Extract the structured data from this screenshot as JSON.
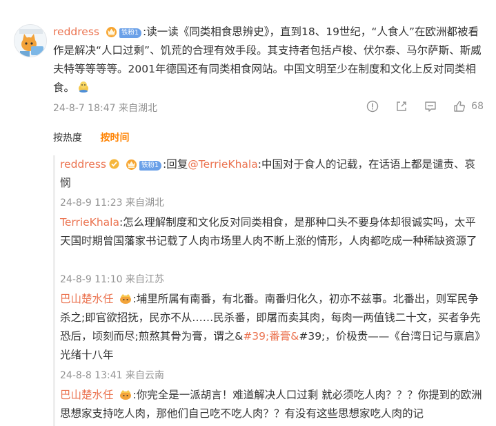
{
  "main_comment": {
    "user": "reddress",
    "fan_badge": "铁粉1",
    "text": ":读一读《同类相食思辨史》，直到18、19世纪，“人食人”在欧洲都被看作是解决“人口过剩”、饥荒的合理有效手段。其支持者包括卢梭、伏尔泰、马尔萨斯、斯威夫特等等等等。2001年德国还有同类相食网站。中国文明至少在制度和文化上反对同类相食。",
    "emoji_icon": "doge-emoji-icon",
    "time_location": "24-8-7 18:47 来自湖北",
    "like_count": "68"
  },
  "actions": {
    "icons": [
      "info-icon",
      "share-icon",
      "comment-icon",
      "like-icon"
    ]
  },
  "sort": {
    "hot": "按热度",
    "time": "按时间"
  },
  "replies": [
    {
      "user": "reddress",
      "fan_badge": "铁粉1",
      "prefix": ":回复",
      "mention": "@TerrieKhala",
      "text": ":中国对于食人的记载，在话语上都是谴责、哀悯",
      "time_location": "24-8-9 11:23 来自湖北"
    },
    {
      "user": "TerrieKhala",
      "text": ":怎么理解制度和文化反对同类相食，是那种口头不要身体却很诚实吗，太平天国时期曾国藩家书记载了人肉市场里人肉不断上涨的情形，人肉都吃成一种稀缺资源了",
      "time_location": "24-8-9 11:10 来自江苏"
    },
    {
      "user": "巴山楚水任",
      "text_a": ":埔里所属有南番，有北番。南番归化久，初亦不兹事。北番出，则军民争杀之;即官欲招抚，民亦不从……民杀番，即屠而卖其肉，每肉一两值钱二十文，买者争先恐后，顷刻而尽;煎熬其骨为膏，谓之&",
      "link1": "#39;番膏&",
      "text_b": "#39;，价极贵——《台湾日记与禀启》光绪十八年",
      "time_location": "24-8-8 13:41 来自云南"
    },
    {
      "user": "巴山楚水任",
      "text": ":你完全是一派胡言！难道解决人口过剩 就必须吃人肉？？？你提到的欧洲思想家支持吃人肉，那他们自己吃不吃人肉？？有没有这些思想家吃人肉的记"
    }
  ],
  "colors": {
    "username": "#eb7350",
    "active_sort": "#ff8200",
    "meta": "#939393",
    "fan_badge": "#6aa0e8"
  }
}
